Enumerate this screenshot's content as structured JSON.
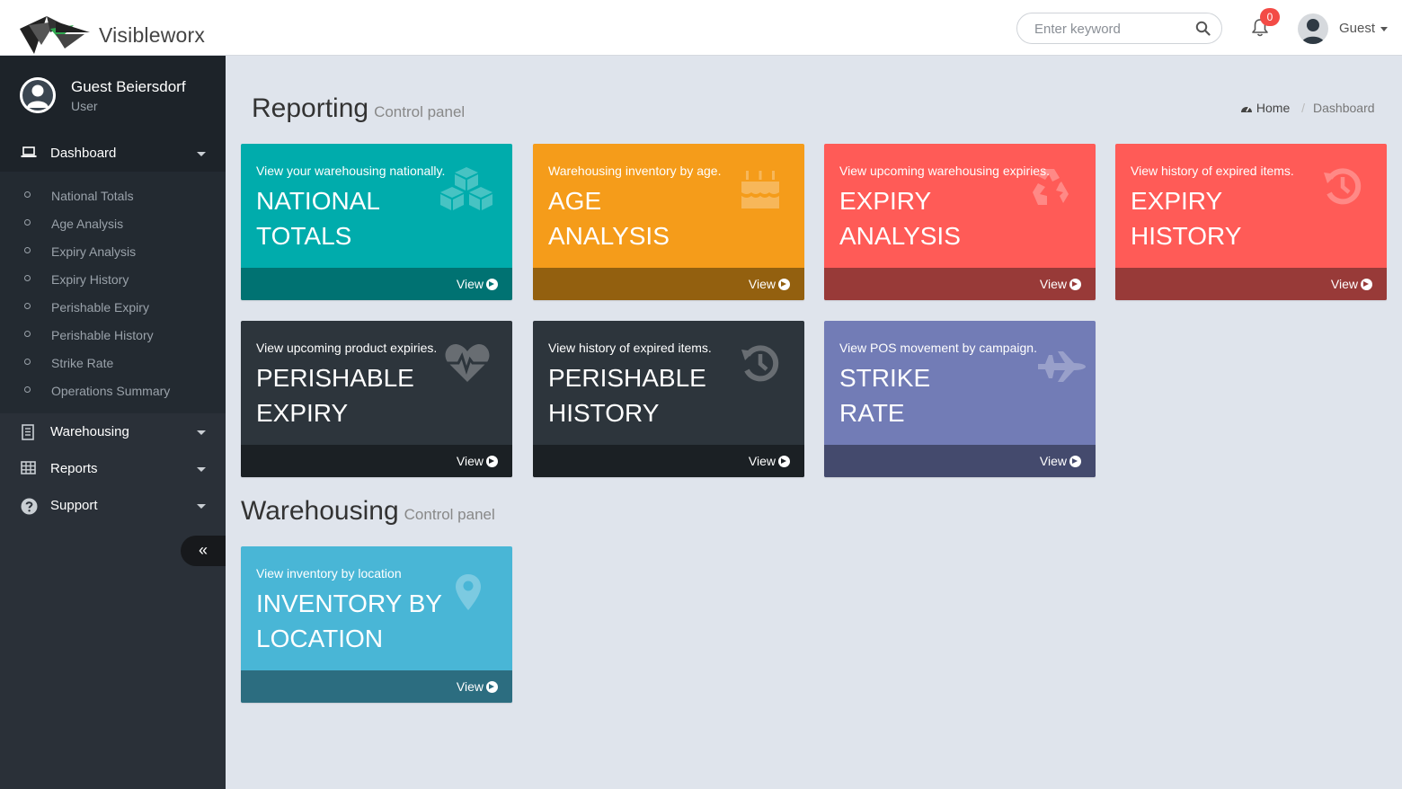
{
  "app": {
    "brand_name": "Visibleworx",
    "search_placeholder": "Enter keyword",
    "notification_count": "0",
    "user_menu_label": "Guest"
  },
  "sidebar": {
    "user_name": "Guest Beiersdorf",
    "user_role": "User",
    "dashboard_label": "Dashboard",
    "dashboard_items": [
      "National Totals",
      "Age Analysis",
      "Expiry Analysis",
      "Expiry History",
      "Perishable Expiry",
      "Perishable History",
      "Strike Rate",
      "Operations Summary"
    ],
    "warehousing_label": "Warehousing",
    "reports_label": "Reports",
    "support_label": "Support",
    "collapse_glyph": "«"
  },
  "reporting": {
    "title": "Reporting",
    "subtitle": "Control panel",
    "breadcrumb_home": "Home",
    "breadcrumb_current": "Dashboard"
  },
  "warehousing_section": {
    "title": "Warehousing",
    "subtitle": "Control panel"
  },
  "tiles": [
    {
      "desc": "View your warehousing nationally.",
      "line1": "NATIONAL",
      "line2": "TOTALS",
      "view": "View",
      "icon": "cubes-icon",
      "color": "#00acac",
      "footer": "#007272"
    },
    {
      "desc": "Warehousing inventory by age.",
      "line1": "AGE",
      "line2": "ANALYSIS",
      "view": "View",
      "icon": "birthday-cake-icon",
      "color": "#f59c1a",
      "footer": "#93600f"
    },
    {
      "desc": "View upcoming warehousing expiries.",
      "line1": "EXPIRY",
      "line2": "ANALYSIS",
      "view": "View",
      "icon": "recycle-icon",
      "color": "#ff5b57",
      "footer": "#983a38"
    },
    {
      "desc": "View history of expired items.",
      "line1": "EXPIRY",
      "line2": "HISTORY",
      "view": "View",
      "icon": "history-icon",
      "color": "#ff5b57",
      "footer": "#983a38"
    },
    {
      "desc": "View upcoming product expiries.",
      "line1": "PERISHABLE",
      "line2": "EXPIRY",
      "view": "View",
      "icon": "heartbeat-icon",
      "color": "#2d353c",
      "footer": "#1b2024"
    },
    {
      "desc": "View history of expired items.",
      "line1": "PERISHABLE",
      "line2": "HISTORY",
      "view": "View",
      "icon": "history-icon",
      "color": "#2d353c",
      "footer": "#1b2024"
    },
    {
      "desc": "View POS movement by campaign.",
      "line1": "STRIKE",
      "line2": "RATE",
      "view": "View",
      "icon": "fighter-jet-icon",
      "color": "#727cb6",
      "footer": "#444a6d"
    },
    {
      "desc": "View inventory by location",
      "line1": "INVENTORY BY",
      "line2": "LOCATION",
      "view": "View",
      "icon": "map-marker-icon",
      "color": "#49b6d6",
      "footer": "#2c6d80"
    }
  ]
}
